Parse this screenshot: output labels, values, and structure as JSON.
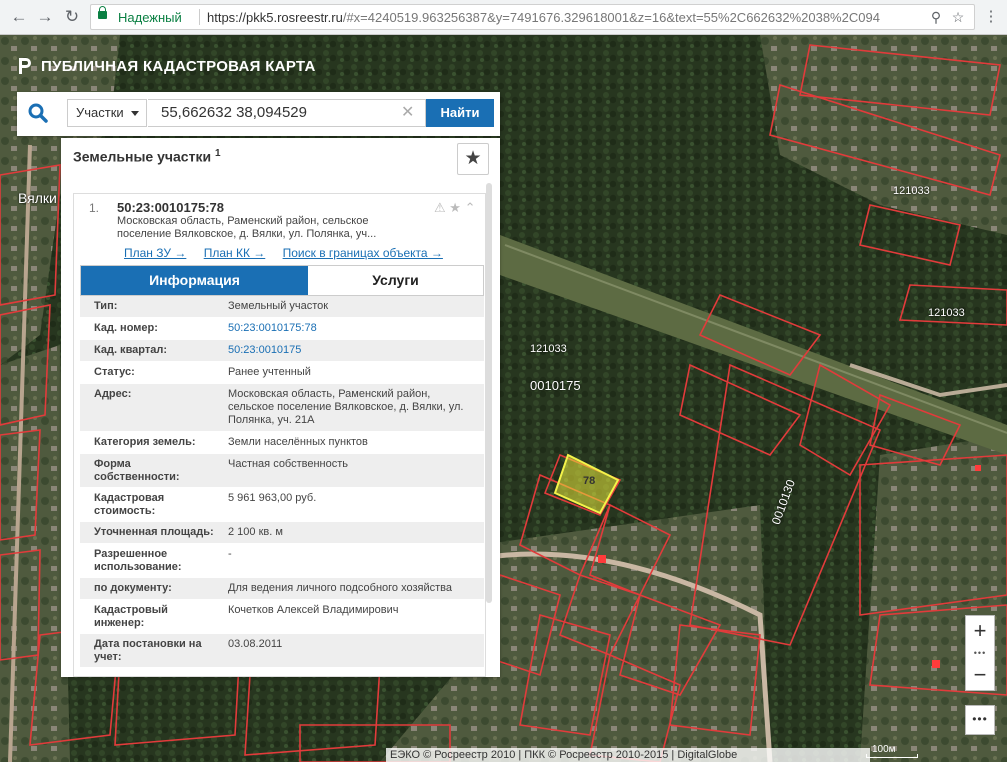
{
  "browser": {
    "secure_label": "Надежный",
    "url_host": "https://pkk5.rosreestr.ru",
    "url_rest": "/#x=4240519.963256387&y=7491676.329618001&z=16&text=55%2C662632%2038%2C094"
  },
  "app": {
    "title": "ПУБЛИЧНАЯ КАДАСТРОВАЯ КАРТА"
  },
  "search": {
    "category": "Участки",
    "query": "55,662632 38,094529",
    "button_label": "Найти"
  },
  "results": {
    "title": "Земельные участки",
    "count_sup": "1",
    "item": {
      "index": "1.",
      "cad_number": "50:23:0010175:78",
      "address_short": "Московская область, Раменский район, сельское поселение Вялковское, д. Вялки, ул. Полянка, уч...",
      "links": [
        "План ЗУ →",
        "План КК →",
        "Поиск в границах объекта →"
      ],
      "tabs": [
        "Информация",
        "Услуги"
      ],
      "rows": [
        {
          "label": "Тип:",
          "value": "Земельный участок",
          "link": false
        },
        {
          "label": "Кад. номер:",
          "value": "50:23:0010175:78",
          "link": true
        },
        {
          "label": "Кад. квартал:",
          "value": "50:23:0010175",
          "link": true
        },
        {
          "label": "Статус:",
          "value": "Ранее учтенный",
          "link": false
        },
        {
          "label": "Адрес:",
          "value": "Московская область, Раменский район, сельское поселение Вялковское, д. Вялки, ул. Полянка, уч. 21А",
          "link": false
        },
        {
          "label": "Категория земель:",
          "value": "Земли населённых пунктов",
          "link": false
        },
        {
          "label": "Форма собственности:",
          "value": "Частная собственность",
          "link": false
        },
        {
          "label": "Кадастровая стоимость:",
          "value": "5 961 963,00 руб.",
          "link": false
        },
        {
          "label": "Уточненная площадь:",
          "value": "2 100 кв. м",
          "link": false
        },
        {
          "label": "Разрешенное использование:",
          "value": "-",
          "link": false
        },
        {
          "label": "по документу:",
          "value": "Для ведения личного подсобного хозяйства",
          "link": false
        },
        {
          "label": "Кадастровый инженер:",
          "value": "Кочетков Алексей Владимирович",
          "link": false
        },
        {
          "label": "Дата постановки на учет:",
          "value": "03.08.2011",
          "link": false
        }
      ]
    }
  },
  "map": {
    "labels": {
      "quarter_a": "0010175",
      "quarter_b": "0010130",
      "code_1": "121033",
      "code_2": "121033",
      "code_3": "121033",
      "selected": "78",
      "village": "Вялки"
    },
    "attribution": "ЕЭКО © Росреестр 2010 | ПКК © Росреестр 2010-2015 | DigitalGlobe",
    "scale": "100м"
  },
  "controls": {
    "zoom_in": "+",
    "zoom_out": "−",
    "dots": "•••"
  }
}
